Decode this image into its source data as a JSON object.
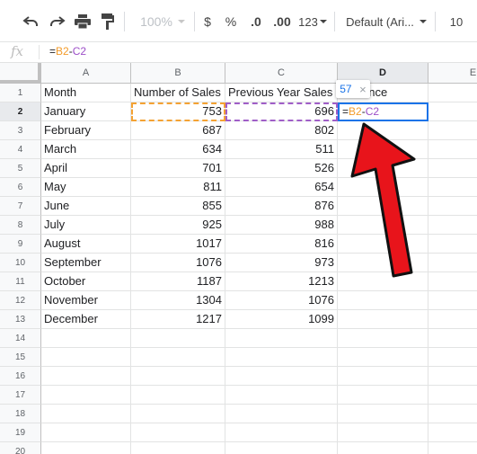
{
  "toolbar": {
    "zoom": "100%",
    "currency": "$",
    "percent": "%",
    "decrease_decimals": ".0",
    "increase_decimals": ".00",
    "more_formats": "123",
    "font": "Default (Ari...",
    "font_size": "10"
  },
  "formula_bar": {
    "fx": "fx",
    "eq": "=",
    "ref1": "B2",
    "op": "-",
    "ref2": "C2"
  },
  "columns": [
    "A",
    "B",
    "C",
    "D",
    "E"
  ],
  "rows": [
    "1",
    "2",
    "3",
    "4",
    "5",
    "6",
    "7",
    "8",
    "9",
    "10",
    "11",
    "12",
    "13",
    "14",
    "15",
    "16",
    "17",
    "18",
    "19",
    "20"
  ],
  "headers": {
    "month": "Month",
    "sales": "Number of Sales",
    "prev": "Previous Year Sales",
    "diff_partial": "ence"
  },
  "data": [
    {
      "month": "January",
      "sales": "753",
      "prev": "696"
    },
    {
      "month": "February",
      "sales": "687",
      "prev": "802"
    },
    {
      "month": "March",
      "sales": "634",
      "prev": "511"
    },
    {
      "month": "April",
      "sales": "701",
      "prev": "526"
    },
    {
      "month": "May",
      "sales": "811",
      "prev": "654"
    },
    {
      "month": "June",
      "sales": "855",
      "prev": "876"
    },
    {
      "month": "July",
      "sales": "925",
      "prev": "988"
    },
    {
      "month": "August",
      "sales": "1017",
      "prev": "816"
    },
    {
      "month": "September",
      "sales": "1076",
      "prev": "973"
    },
    {
      "month": "October",
      "sales": "1187",
      "prev": "1213"
    },
    {
      "month": "November",
      "sales": "1304",
      "prev": "1076"
    },
    {
      "month": "December",
      "sales": "1217",
      "prev": "1099"
    }
  ],
  "edit_cell": {
    "eq": "=",
    "ref1": "B2",
    "op": "-",
    "ref2": "C2"
  },
  "tooltip": {
    "value": "57",
    "close": "×"
  },
  "colors": {
    "accent": "#1a73e8",
    "ref_b": "#f4a233",
    "ref_c": "#a05ec7",
    "arrow": "#e8141b"
  },
  "icons": [
    "undo-icon",
    "redo-icon",
    "print-icon",
    "paint-format-icon",
    "red-arrow-annotation"
  ]
}
